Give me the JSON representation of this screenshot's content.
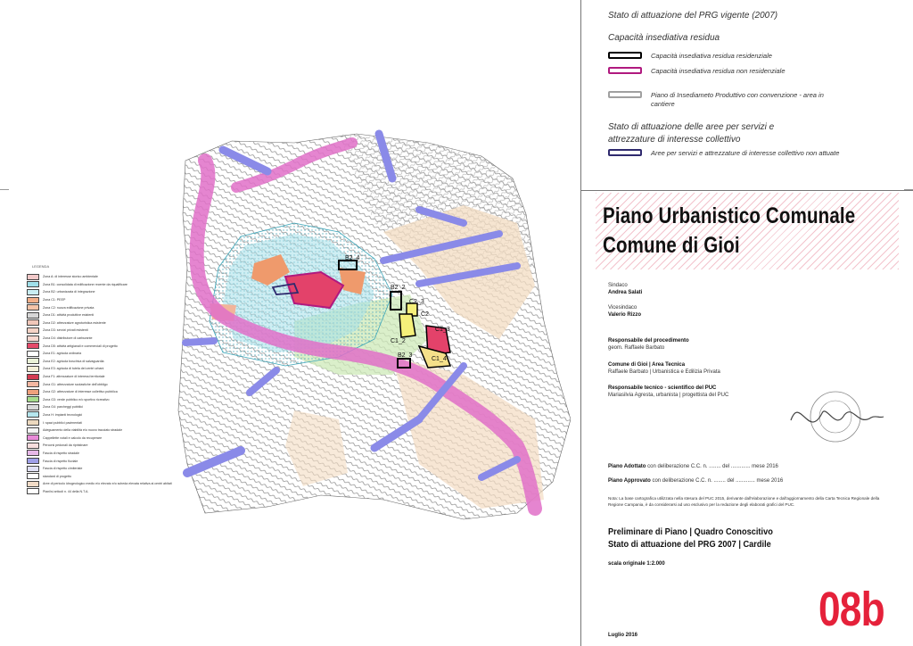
{
  "legend_side": {
    "title": "LEGENDA",
    "items": [
      {
        "label": "Zona A: di interesse storico ambientale",
        "color": "#f2c9c9"
      },
      {
        "label": "Zona B1: consolidata di edificazione recente da riqualificare",
        "color": "#9fe0ea"
      },
      {
        "label": "Zona B2: urbanizzata di integrazione",
        "color": "#c9eef3"
      },
      {
        "label": "Zona C1: PEEP",
        "color": "#f3b08a"
      },
      {
        "label": "Zona C2: nuova edificazione privata",
        "color": "#f5c4a8"
      },
      {
        "label": "Zona D1: attività produttive esistenti",
        "color": "#d7d7d7"
      },
      {
        "label": "Zona D2: attrezzature agroturistica esistente",
        "color": "#f1c7b9"
      },
      {
        "label": "Zona D3: servizi privati esistenti",
        "color": "#f5d3c6"
      },
      {
        "label": "Zona D4: distributore di carburante",
        "color": "#f8d8d0"
      },
      {
        "label": "Zona D5: attività artigianali e commerciali di progetto",
        "color": "#e44a6a"
      },
      {
        "label": "Zona E1: agricola ordinaria",
        "color": "#ffffff"
      },
      {
        "label": "Zona E2: agricola boschiva di salvaguardia",
        "color": "#eaf2d8"
      },
      {
        "label": "Zona E3: agricola di tutela dei centri urbani",
        "color": "#f4f0d8"
      },
      {
        "label": "Zona F1: attrezzature di interessi territoriale",
        "color": "#d43c52"
      },
      {
        "label": "Zona G1: attrezzature scolastiche dell'obbligo",
        "color": "#f3b7a2"
      },
      {
        "label": "Zona G2: attrezzature di interesse collettivo pubblica",
        "color": "#efa17d"
      },
      {
        "label": "Zona G3: verde pubblico e/o sportivo ricreativo",
        "color": "#a7dc8e"
      },
      {
        "label": "Zona G4: parcheggi pubblici",
        "color": "#d9d9d9"
      },
      {
        "label": "Zona H: impianti tecnologici",
        "color": "#b5e6ee"
      },
      {
        "label": "I: spazi pubblici pavimentati",
        "color": "#ecd9bf"
      },
      {
        "label": "Adeguamento della viabilità e/o nuovo tracciato stradale",
        "color": "#f5f5f5"
      },
      {
        "label": "Cappellette votali e calcolo da recuperare",
        "color": "#e88ad8"
      },
      {
        "label": "Percorsi pedonali da ripristinare",
        "color": "#f7dede"
      },
      {
        "label": "Fascia di rispetto stradale",
        "color": "#e7b8e8"
      },
      {
        "label": "Fascia di rispetto fluviale",
        "color": "#9f9fe8"
      },
      {
        "label": "Fascia di rispetto cimiteriale",
        "color": "#e0e0f5"
      },
      {
        "label": "standard di progetto",
        "color": "#ffffff"
      },
      {
        "label": "Aree di pericolo idrogeologico medio e/o elevato e/o scheda elevata relativa ai centri abitati",
        "color": "#f2dcc7"
      },
      {
        "label": "Piani/si articoli n. 44 della N.T.A.",
        "color": "#ffffff"
      }
    ]
  },
  "map_labels": [
    "B2_4",
    "B2_2",
    "C2_3",
    "C2",
    "C1_2",
    "C1_3",
    "B2_3",
    "C1_4"
  ],
  "legend_right": {
    "title": "Stato di attuazione del PRG vigente (2007)",
    "subtitle": "Capacità insediativa residua",
    "items": [
      {
        "label": "Capacità insediativa residua residenziale",
        "color": "#000000"
      },
      {
        "label": "Capacità insediativa residua non residenziale",
        "color": "#b0197f"
      },
      {
        "label": "Piano di Insediameto Produttivo con convenzione - area in cantiere",
        "color": "#a0a0a0"
      }
    ],
    "services_title": "Stato di attuazione delle aree per servizi e attrezzature di interesse collettivo",
    "services_item": {
      "label": "Aree per servizi e attrezzature di interesse collettivo non attuate",
      "color": "#2f2a6e"
    }
  },
  "title_block": {
    "line1": "Piano Urbanistico Comunale",
    "line2": "Comune di Gioi",
    "sindaco_label": "Sindaco",
    "sindaco_name": "Andrea Salati",
    "vicesindaco_label": "Vicesindaco",
    "vicesindaco_name": "Valerio Rizzo",
    "resp_proc_label": "Responsabile del procedimento",
    "resp_proc_name": "geom. Raffaele Barbato",
    "area_tecnica_label": "Comune di Gioi | Area Tecnica",
    "area_tecnica_name": "Raffaele Barbato | Urbanistica e Edilizia Privata",
    "resp_tec_label": "Responsabile tecnico - scientifico del PUC",
    "resp_tec_name": "Mariasilvia Agresta, urbanista | progettista del PUC",
    "adottato_label": "Piano Adottato",
    "adottato_text": "con deliberazione C.C. n. ........ del ............. mese 2016",
    "approvato_label": "Piano Approvato",
    "approvato_text": "con deliberazione C.C. n. ........ del ............. mese 2016",
    "nota": "Nota: La base cartografica utilizzata nella stesura del PUC 2015, derivante dall'elaborazione e dall'aggiornamento della Carta Tecnica Regionale della Regione Campania, è da considerarsi ad uso esclusivo per la redazione degli elaborati grafici del PUC.",
    "phase": "Preliminare di Piano | Quadro Conoscitivo",
    "subject": "Stato di attuazione del PRG 2007 | Cardile",
    "scale": "scala originale 1:2.000",
    "date": "Luglio 2016",
    "code": "08b",
    "code_color": "#e5213a"
  }
}
